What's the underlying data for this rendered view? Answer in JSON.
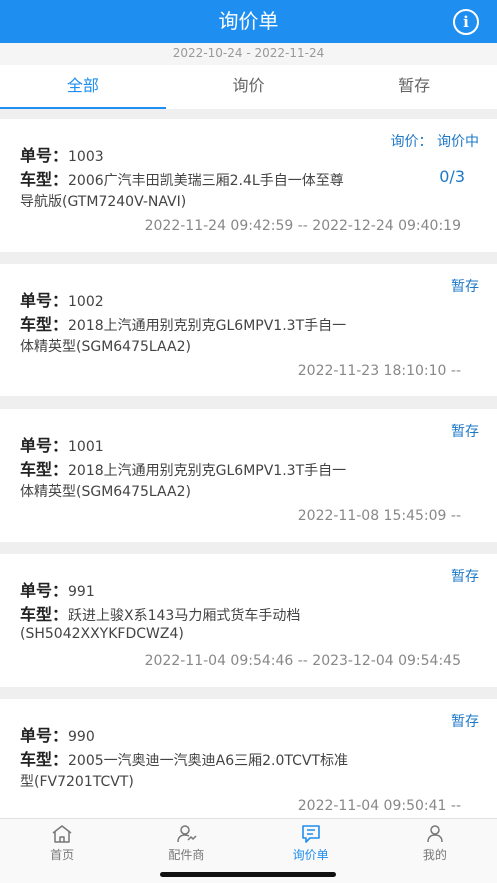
{
  "header": {
    "title": "询价单",
    "info_icon": "info-icon"
  },
  "date_range": "2022-10-24 - 2022-11-24",
  "tabs": [
    {
      "label": "全部",
      "active": true
    },
    {
      "label": "询价",
      "active": false
    },
    {
      "label": "暂存",
      "active": false
    }
  ],
  "labels": {
    "order_no": "单号：",
    "model": "车型："
  },
  "orders": [
    {
      "status": "询价：  询价中",
      "progress": "0/3",
      "number": "1003",
      "model_line1": "2006广汽丰田凯美瑞三厢2.4L手自一体至尊",
      "model_line2": "导航版(GTM7240V-NAVI)",
      "time": "2022-11-24 09:42:59 -- 2022-12-24 09:40:19"
    },
    {
      "status": "暂存",
      "progress": "",
      "number": "1002",
      "model_line1": "2018上汽通用别克别克GL6MPV1.3T手自一",
      "model_line2": "体精英型(SGM6475LAA2)",
      "time": "2022-11-23 18:10:10 --"
    },
    {
      "status": "暂存",
      "progress": "",
      "number": "1001",
      "model_line1": "2018上汽通用别克别克GL6MPV1.3T手自一",
      "model_line2": "体精英型(SGM6475LAA2)",
      "time": "2022-11-08 15:45:09 --"
    },
    {
      "status": "暂存",
      "progress": "",
      "number": "991",
      "model_line1": "跃进上骏X系143马力厢式货车手动档",
      "model_line2": "(SH5042XXYKFDCWZ4)",
      "time": "2022-11-04 09:54:46 -- 2023-12-04 09:54:45"
    },
    {
      "status": "暂存",
      "progress": "",
      "number": "990",
      "model_line1": "2005一汽奥迪一汽奥迪A6三厢2.0TCVT标准",
      "model_line2": "型(FV7201TCVT)",
      "time": "2022-11-04 09:50:41 --"
    }
  ],
  "tabbar": [
    {
      "label": "首页",
      "icon": "home-icon",
      "active": false
    },
    {
      "label": "配件商",
      "icon": "supplier-icon",
      "active": false
    },
    {
      "label": "询价单",
      "icon": "inquiry-list-icon",
      "active": true
    },
    {
      "label": "我的",
      "icon": "profile-icon",
      "active": false
    }
  ],
  "colors": {
    "primary": "#1e8ef0",
    "status": "#1e78c8",
    "background": "#efefef"
  }
}
